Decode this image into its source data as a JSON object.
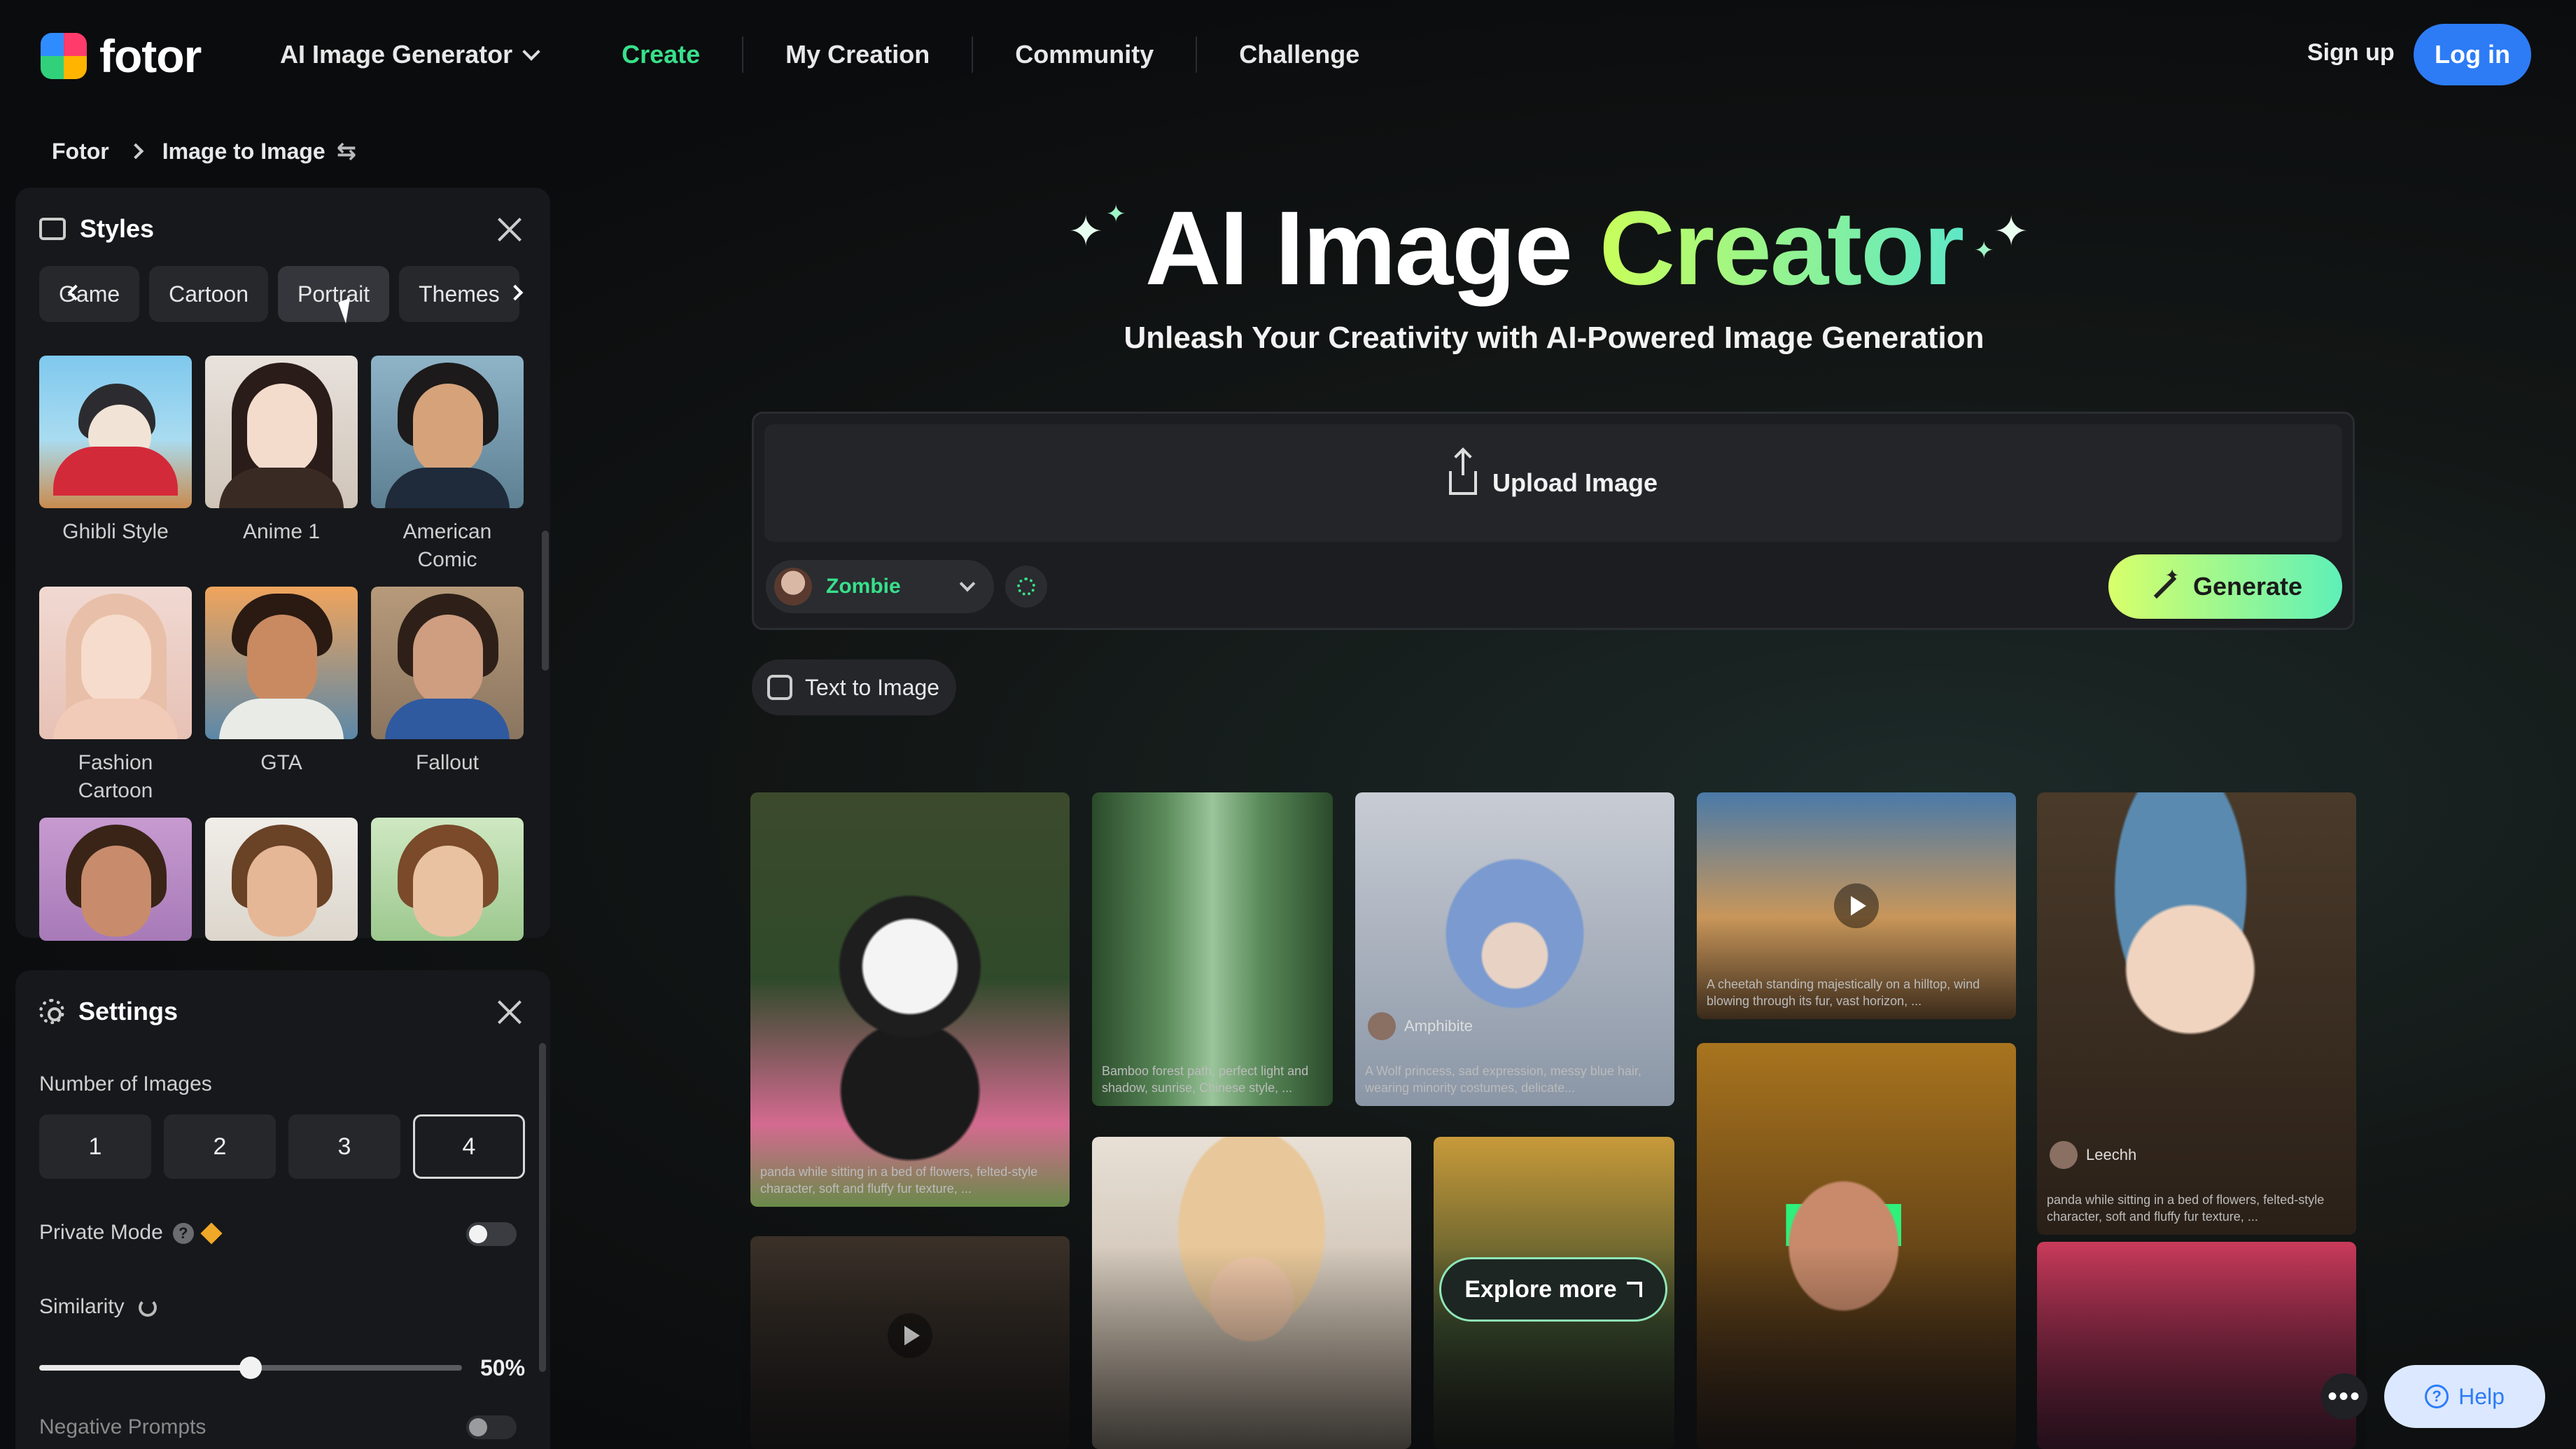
{
  "nav": {
    "logo": "fotor",
    "items": [
      {
        "label": "AI Image Generator",
        "dropdown": true
      },
      {
        "label": "Create",
        "active": true
      },
      {
        "label": "My Creation"
      },
      {
        "label": "Community"
      },
      {
        "label": "Challenge"
      }
    ],
    "signup": "Sign up",
    "login": "Log in"
  },
  "breadcrumb": [
    "Fotor",
    "Image to Image"
  ],
  "styles_panel": {
    "title": "Styles",
    "tabs": [
      "Game",
      "Cartoon",
      "Portrait",
      "Themes"
    ],
    "selected_tab": "Portrait",
    "items": [
      {
        "label": "Ghibli Style"
      },
      {
        "label": "Anime 1"
      },
      {
        "label": "American Comic"
      },
      {
        "label": "Fashion Cartoon"
      },
      {
        "label": "GTA"
      },
      {
        "label": "Fallout"
      },
      {
        "label": ""
      },
      {
        "label": ""
      },
      {
        "label": ""
      }
    ]
  },
  "settings_panel": {
    "title": "Settings",
    "number_of_images_label": "Number of Images",
    "number_options": [
      "1",
      "2",
      "3",
      "4"
    ],
    "selected_number": "4",
    "private_mode_label": "Private Mode",
    "private_mode_on": false,
    "similarity_label": "Similarity",
    "similarity_value": "50%",
    "similarity_fraction": 0.5,
    "negative_prompts_label": "Negative Prompts",
    "negative_prompts_on": false
  },
  "hero": {
    "title_part1": "AI Image",
    "title_part2": "Creator",
    "subtitle": "Unleash Your Creativity with AI-Powered Image Generation"
  },
  "generator": {
    "upload_label": "Upload Image",
    "model": "Zombie",
    "generate_label": "Generate",
    "text_to_image_label": "Text to Image"
  },
  "gallery": {
    "explore_label": "Explore more",
    "captions": {
      "bamboo": "Bamboo forest path, perfect light and shadow, sunrise, Chinese style, ...",
      "wolf_user": "Amphibite",
      "wolf": "A Wolf princess, sad expression, messy blue hair, wearing minority costumes, delicate...",
      "cheetah": "A cheetah standing majestically on a hilltop, wind blowing through its fur, vast horizon, ...",
      "girl_user": "Leechh",
      "girl": "panda while sitting in a bed of flowers, felted-style character, soft and fluffy fur texture, ...",
      "panda": "panda while sitting in a bed of flowers, felted-style character, soft and fluffy fur texture, ..."
    }
  },
  "help_label": "Help",
  "colors": {
    "accent_green": "#38e08a",
    "login_blue": "#2d7cf6",
    "generate_gradient_start": "#d8ff6a",
    "generate_gradient_end": "#5ef0b8"
  }
}
